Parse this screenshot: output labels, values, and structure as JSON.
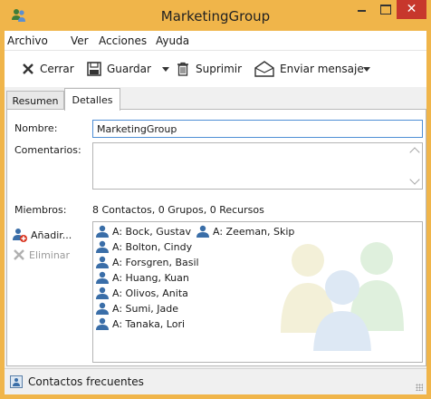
{
  "window": {
    "title": "MarketingGroup",
    "accent_color": "#f0b54a",
    "close_color": "#c7372c"
  },
  "menu": [
    "Archivo",
    "Ver",
    "Acciones",
    "Ayuda"
  ],
  "toolbar": {
    "close_label": "Cerrar",
    "save_label": "Guardar",
    "delete_label": "Suprimir",
    "send_label": "Enviar mensaje"
  },
  "tabs": {
    "summary": "Resumen",
    "details": "Detalles",
    "selected": "Detalles"
  },
  "details": {
    "name_label": "Nombre:",
    "name_value": "MarketingGroup",
    "comments_label": "Comentarios:",
    "comments_value": "",
    "members_label": "Miembros:",
    "members_summary": "8 Contactos, 0 Grupos, 0 Recursos",
    "add_label": "Añadir...",
    "remove_label": "Eliminar"
  },
  "members": [
    "A: Bock, Gustav",
    "A: Zeeman, Skip",
    "A: Bolton, Cindy",
    "A: Forsgren, Basil",
    "A: Huang, Kuan",
    "A: Olivos, Anita",
    "A: Sumi, Jade",
    "A: Tanaka, Lori"
  ],
  "status": {
    "frequent_contacts": "Contactos frecuentes"
  },
  "icons": {
    "app": "people-icon",
    "close": "x-icon",
    "save": "floppy-icon",
    "delete": "trash-icon",
    "send": "envelope-icon",
    "member": "person-icon",
    "add": "add-person-icon",
    "remove": "x-icon"
  }
}
